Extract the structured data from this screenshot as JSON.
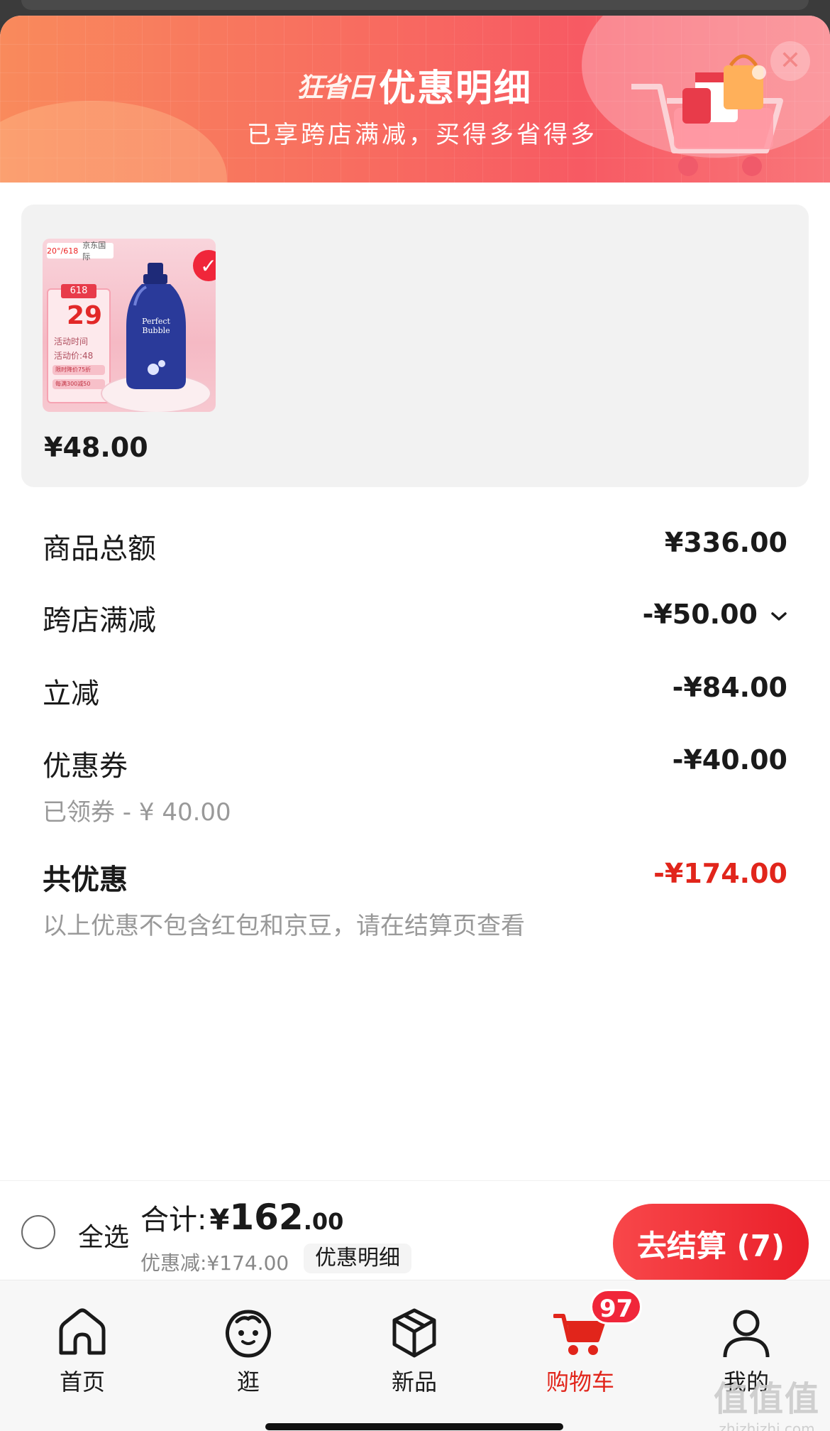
{
  "header": {
    "brand": "狂省日",
    "title": "优惠明细",
    "subtitle": "已享跨店满减，买得多省得多"
  },
  "product": {
    "price": "¥48.00",
    "thumb": {
      "tag_left": "20°/618",
      "tag_right": "京东国际",
      "event": "618",
      "date": "29",
      "activity_time": "活动时间",
      "activity_price": "活动价:48",
      "bar1": "限时降价75折",
      "bar2": "每满300减50",
      "bottle_text": "Perfect Bubble"
    }
  },
  "breakdown": {
    "subtotal_label": "商品总额",
    "subtotal_value": "¥336.00",
    "cross_store_label": "跨店满减",
    "cross_store_value": "-¥50.00",
    "instant_label": "立减",
    "instant_value": "-¥84.00",
    "coupon_label": "优惠券",
    "coupon_value": "-¥40.00",
    "coupon_sub": "已领券 - ¥ 40.00",
    "total_discount_label": "共优惠",
    "total_discount_value": "-¥174.00",
    "note": "以上优惠不包含红包和京豆，请在结算页查看"
  },
  "checkout": {
    "select_all": "全选",
    "total_label": "合计:",
    "currency": "¥",
    "total_int": "162",
    "total_dec": ".00",
    "discount_text": "优惠减:¥174.00",
    "detail_label": "优惠明细",
    "button_label": "去结算 (7)"
  },
  "tabs": [
    {
      "label": "首页",
      "icon": "home-icon"
    },
    {
      "label": "逛",
      "icon": "browse-icon"
    },
    {
      "label": "新品",
      "icon": "box-icon"
    },
    {
      "label": "购物车",
      "icon": "cart-icon",
      "badge": "97",
      "active": true
    },
    {
      "label": "我的",
      "icon": "user-icon"
    }
  ],
  "watermark": {
    "line1": "值值值",
    "line2": "zhizhizhi.com"
  },
  "colors": {
    "accent": "#e1251b",
    "banner_start": "#f98a5c",
    "banner_end": "#f75a63"
  }
}
